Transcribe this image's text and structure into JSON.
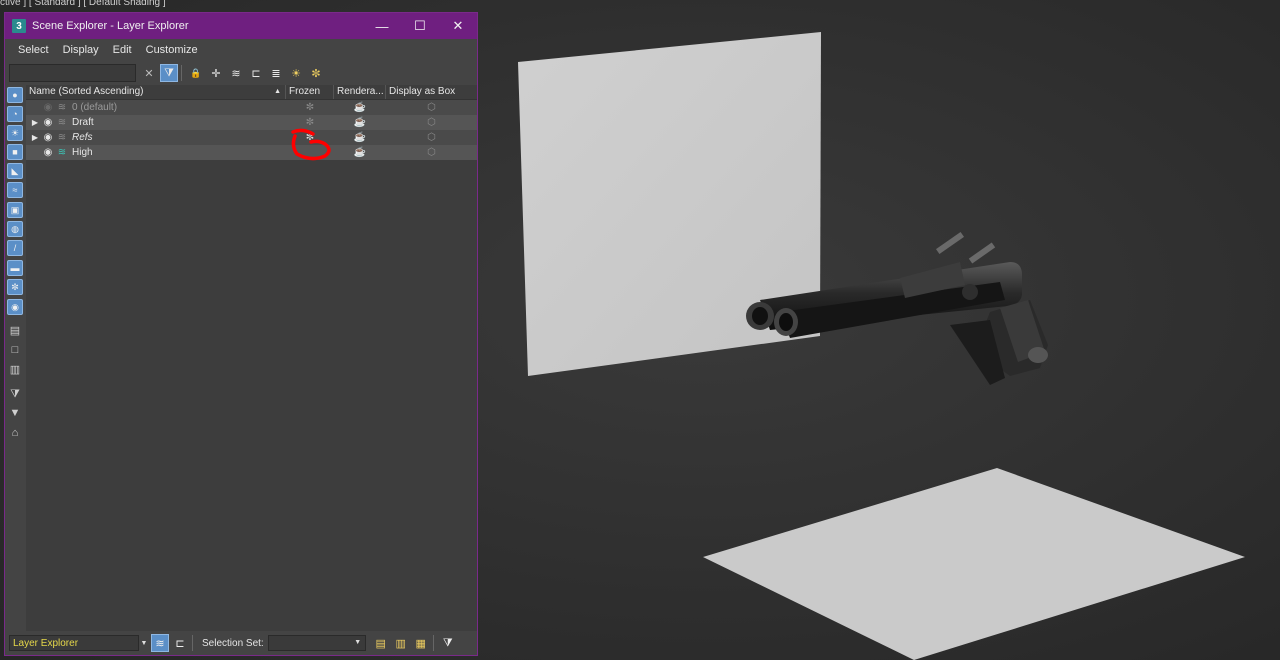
{
  "viewport": {
    "label": "ctive ] [ Standard ] [ Default Shading ]"
  },
  "window": {
    "title": "Scene Explorer - Layer Explorer",
    "app_icon": "3",
    "buttons": {
      "minimize": "—",
      "maximize": "☐",
      "close": "✕"
    }
  },
  "menu": {
    "items": [
      "Select",
      "Display",
      "Edit",
      "Customize"
    ]
  },
  "toolbar": {
    "search_placeholder": "",
    "clear_icon": "✕",
    "icons": [
      {
        "name": "filter-icon",
        "glyph": "⧩",
        "active": true
      },
      {
        "name": "lock-icon",
        "glyph": "🔒"
      },
      {
        "name": "add-layer-icon",
        "glyph": "✛"
      },
      {
        "name": "layers-stack-icon",
        "glyph": "≋"
      },
      {
        "name": "hierarchy-icon",
        "glyph": "⊏"
      },
      {
        "name": "layers-icon",
        "glyph": "≣"
      },
      {
        "name": "highlight-icon",
        "glyph": "☀"
      },
      {
        "name": "freeze-add-icon",
        "glyph": "✼"
      }
    ]
  },
  "left_icons": [
    {
      "name": "geometry-icon",
      "glyph": "●"
    },
    {
      "name": "shapes-icon",
      "glyph": "◔"
    },
    {
      "name": "lights-icon",
      "glyph": "☀"
    },
    {
      "name": "cameras-icon",
      "glyph": "■"
    },
    {
      "name": "helpers-icon",
      "glyph": "◣"
    },
    {
      "name": "spacewarps-icon",
      "glyph": "≈"
    },
    {
      "name": "groups-icon",
      "glyph": "▣"
    },
    {
      "name": "xrefs-icon",
      "glyph": "◍"
    },
    {
      "name": "bones-icon",
      "glyph": "/"
    },
    {
      "name": "containers-icon",
      "glyph": "▬"
    },
    {
      "name": "frozen-icon",
      "glyph": "✼"
    },
    {
      "name": "hidden-icon",
      "glyph": "◉"
    },
    {
      "name": "doc-icon-1",
      "glyph": "▤"
    },
    {
      "name": "doc-icon-2",
      "glyph": "□"
    },
    {
      "name": "doc-icon-3",
      "glyph": "▥"
    },
    {
      "name": "filter-icon-a",
      "glyph": "⧩"
    },
    {
      "name": "filter-icon-b",
      "glyph": "▼"
    },
    {
      "name": "tag-icon",
      "glyph": "⌂"
    }
  ],
  "table": {
    "headers": {
      "name": "Name (Sorted Ascending)",
      "sort": "▲",
      "frozen": "Frozen",
      "renderable": "Rendera...",
      "display_as_box": "Display as Box"
    },
    "rows": [
      {
        "name": "0 (default)",
        "expander": "",
        "eye": "◉",
        "frozen": "✼",
        "render": "☕",
        "box": "⬡",
        "dim": true,
        "italic": false,
        "active_layer": false
      },
      {
        "name": "Draft",
        "expander": "▶",
        "eye": "◉",
        "frozen": "✼",
        "render": "☕",
        "box": "⬡",
        "dim": false,
        "italic": false,
        "active_layer": false
      },
      {
        "name": "Refs",
        "expander": "▶",
        "eye": "◉",
        "frozen": "✼",
        "render": "☕",
        "box": "⬡",
        "dim": false,
        "italic": true,
        "active_layer": false
      },
      {
        "name": "High",
        "expander": "",
        "eye": "◉",
        "frozen": "",
        "render": "☕",
        "box": "⬡",
        "dim": false,
        "italic": false,
        "active_layer": true
      }
    ]
  },
  "bottom": {
    "explorer_name": "Layer Explorer",
    "selection_set_label": "Selection Set:",
    "selection_set_value": "",
    "dropdown_arrow": "▼"
  },
  "colors": {
    "title_bar": "#6f1f80",
    "accent_blue": "#5b8fc7",
    "annotation_red": "#ff0000",
    "active_layer": "#3cc6b8"
  }
}
